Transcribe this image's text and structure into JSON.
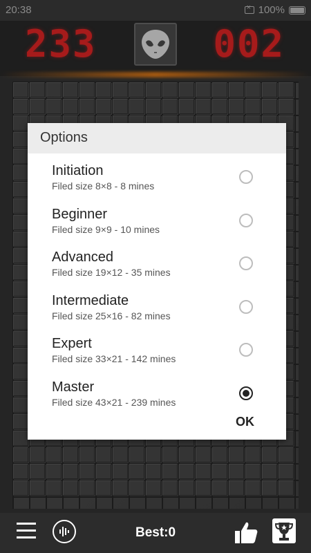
{
  "status": {
    "time": "20:38",
    "battery": "100%"
  },
  "header": {
    "timer": "233",
    "mines": "002"
  },
  "dialog": {
    "title": "Options",
    "options": [
      {
        "name": "Initiation",
        "desc": "Filed size 8×8 - 8 mines",
        "selected": false
      },
      {
        "name": "Beginner",
        "desc": "Filed size 9×9 - 10 mines",
        "selected": false
      },
      {
        "name": "Advanced",
        "desc": "Filed size 19×12 - 35 mines",
        "selected": false
      },
      {
        "name": "Intermediate",
        "desc": "Filed size 25×16 - 82 mines",
        "selected": false
      },
      {
        "name": "Expert",
        "desc": "Filed size 33×21 - 142 mines",
        "selected": false
      },
      {
        "name": "Master",
        "desc": "Filed size 43×21 - 239 mines",
        "selected": true
      }
    ],
    "ok_label": "OK"
  },
  "bottom": {
    "best": "Best:0"
  }
}
